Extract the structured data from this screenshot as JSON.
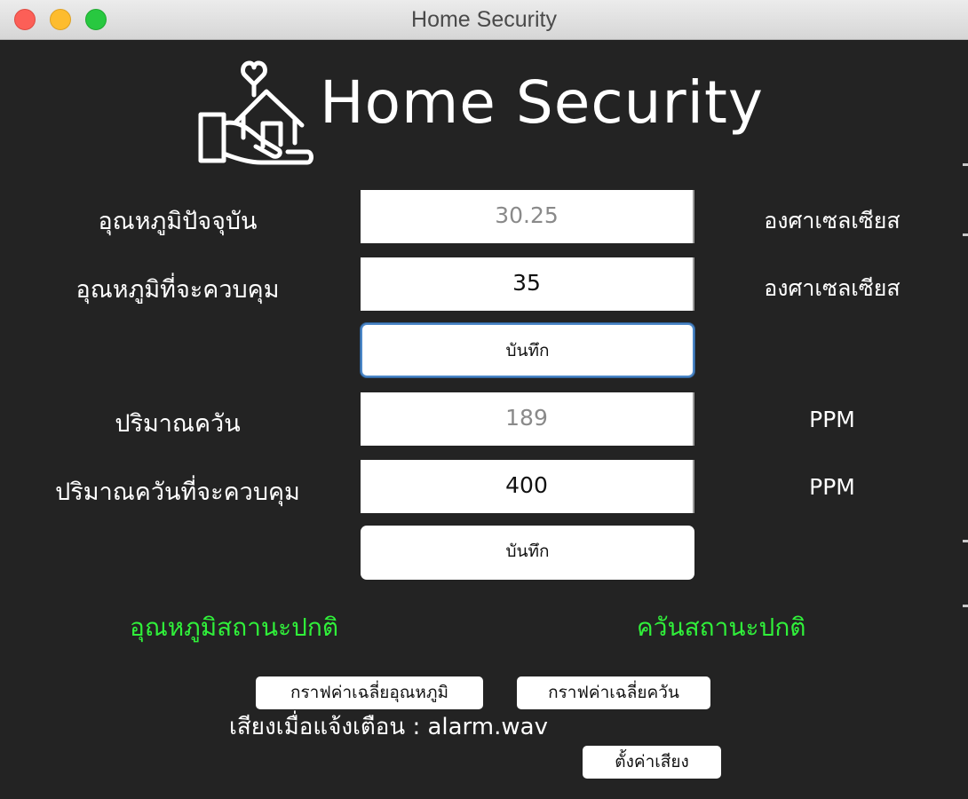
{
  "window": {
    "title": "Home Security"
  },
  "app": {
    "heading": "Home Security",
    "logo_icon": "hand-holding-house-heart-icon"
  },
  "temperature": {
    "current_label": "อุณหภูมิปัจจุบัน",
    "current_value": "30.25",
    "current_unit": "องศาเซลเซียส",
    "target_label": "อุณหภูมิที่จะควบคุม",
    "target_value": "35",
    "target_unit": "องศาเซลเซียส",
    "save_label": "บันทึก",
    "status": "อุณหภูมิสถานะปกติ"
  },
  "smoke": {
    "current_label": "ปริมาณควัน",
    "current_value": "189",
    "current_unit": "PPM",
    "target_label": "ปริมาณควันที่จะควบคุม",
    "target_value": "400",
    "target_unit": "PPM",
    "save_label": "บันทึก",
    "status": "ควันสถานะปกติ"
  },
  "graphs": {
    "temp_avg_label": "กราฟค่าเฉลี่ยอุณหภูมิ",
    "smoke_avg_label": "กราฟค่าเฉลี่ยควัน"
  },
  "sound": {
    "label": "เสียงเมื่อแจ้งเตือน : alarm.wav",
    "settings_label": "ตั้งค่าเสียง"
  },
  "colors": {
    "background": "#232323",
    "status_ok": "#30f03a",
    "focus_ring": "#4b86c7"
  }
}
